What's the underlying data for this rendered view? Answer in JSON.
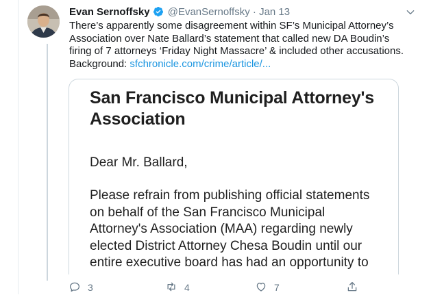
{
  "tweet": {
    "display_name": "Evan Sernoffsky",
    "handle": "@EvanSernoffsky",
    "separator": "·",
    "date": "Jan 13",
    "text_lines": [
      "There’s apparently some disagreement within SF’s Municipal Attorney’s",
      "Association over Nate Ballard’s statement that called new DA Boudin’s",
      "firing of 7 attorneys ‘Friday Night Massacre’ & included other accusations."
    ],
    "background_label": "Background:",
    "link_text": "sfchronicle.com/crime/article/..."
  },
  "card": {
    "title": "San Francisco Municipal Attorney's Association",
    "greeting": "Dear Mr. Ballard,",
    "body_lines": [
      "Please refrain from publishing official statements",
      "on behalf of the San Francisco Municipal",
      "Attorney's Association (MAA) regarding newly",
      "elected District Attorney Chesa Boudin until our",
      "entire executive board has had an opportunity to"
    ]
  },
  "actions": {
    "reply_count": "3",
    "retweet_count": "4",
    "like_count": "7"
  },
  "colors": {
    "accent": "#1da1f2",
    "link": "#1b95e0",
    "muted": "#657786",
    "border": "#ccd6dd"
  },
  "icons": [
    "verified-badge-icon",
    "chevron-down-icon",
    "reply-icon",
    "retweet-icon",
    "like-icon",
    "share-icon"
  ]
}
